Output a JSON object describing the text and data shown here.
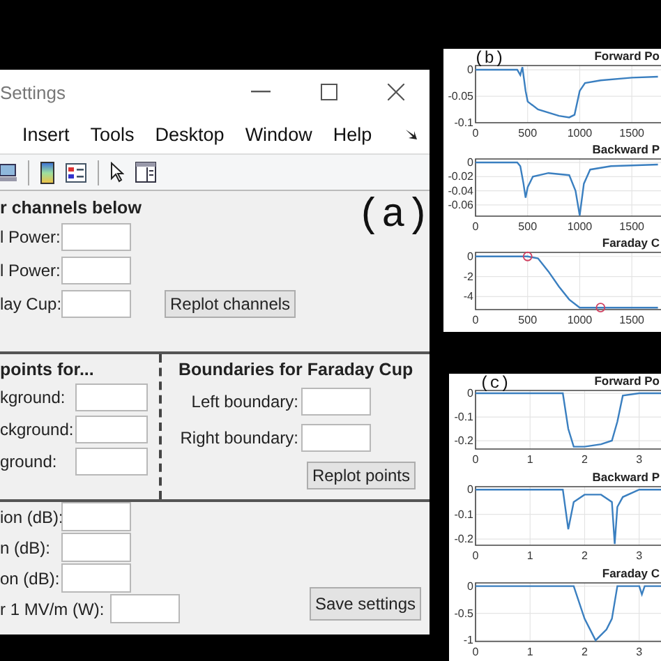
{
  "window": {
    "title": "Settings"
  },
  "menu": [
    "Insert",
    "Tools",
    "Desktop",
    "Window",
    "Help"
  ],
  "panel_label": "(a)",
  "channels": {
    "heading": "r channels below",
    "fields": [
      "l Power:",
      "l Power:",
      "lay Cup:"
    ],
    "button": "Replot channels"
  },
  "points": {
    "heading": "points for...",
    "fields": [
      "kground:",
      "ckground:",
      "ground:"
    ]
  },
  "boundaries": {
    "heading": "Boundaries for Faraday Cup",
    "fields": [
      "Left boundary:",
      "Right boundary:"
    ],
    "button": "Replot points"
  },
  "calibration": {
    "fields": [
      "ion (dB):",
      "n (dB):",
      "on (dB):",
      "r 1 MV/m (W):"
    ],
    "button": "Save settings"
  },
  "figures": [
    {
      "label": "(b)",
      "plots": [
        {
          "chart_data": {
            "type": "line",
            "title": "Forward Po",
            "grid": true,
            "x": [
              0,
              400,
              430,
              450,
              480,
              500,
              600,
              800,
              900,
              950,
              1000,
              1050,
              1200,
              1500,
              1750
            ],
            "series": [
              {
                "color": "#3a7fc0",
                "values": [
                  0,
                  0,
                  -0.01,
                  0.005,
                  -0.04,
                  -0.06,
                  -0.075,
                  -0.087,
                  -0.09,
                  -0.085,
                  -0.04,
                  -0.025,
                  -0.02,
                  -0.015,
                  -0.013
                ]
              }
            ],
            "xlim": [
              0,
              1780
            ],
            "ylim": [
              -0.1,
              0.008
            ],
            "xticks": [
              0,
              500,
              1000,
              1500
            ],
            "yticks": [
              0,
              -0.05,
              -0.1
            ]
          }
        },
        {
          "chart_data": {
            "type": "line",
            "title": "Backward P",
            "grid": true,
            "x": [
              0,
              400,
              430,
              460,
              480,
              500,
              550,
              700,
              900,
              960,
              1000,
              1040,
              1100,
              1300,
              1750
            ],
            "series": [
              {
                "color": "#3a7fc0",
                "values": [
                  0,
                  0,
                  -0.005,
                  -0.03,
                  -0.05,
                  -0.035,
                  -0.02,
                  -0.015,
                  -0.018,
                  -0.04,
                  -0.075,
                  -0.03,
                  -0.01,
                  -0.005,
                  -0.003
                ]
              }
            ],
            "xlim": [
              0,
              1780
            ],
            "ylim": [
              -0.076,
              0.005
            ],
            "xticks": [
              0,
              500,
              1000,
              1500
            ],
            "yticks": [
              0,
              -0.02,
              -0.04,
              -0.06
            ]
          }
        },
        {
          "chart_data": {
            "type": "line",
            "title": "Faraday C",
            "grid": true,
            "x": [
              0,
              500,
              600,
              700,
              800,
              900,
              1000,
              1200,
              1500,
              1750
            ],
            "series": [
              {
                "color": "#3a7fc0",
                "values": [
                  0,
                  0,
                  -0.2,
                  -1.5,
                  -3,
                  -4.3,
                  -5.1,
                  -5.1,
                  -5.1,
                  -5.1
                ]
              },
              {
                "type": "scatter",
                "color": "#d04060",
                "values": [
                  null,
                  0,
                  null,
                  null,
                  null,
                  null,
                  null,
                  -5.1,
                  null,
                  null
                ]
              }
            ],
            "xlim": [
              0,
              1780
            ],
            "ylim": [
              -5.3,
              0.4
            ],
            "xticks": [
              0,
              500,
              1000,
              1500
            ],
            "yticks": [
              0,
              -2,
              -4
            ]
          }
        }
      ]
    },
    {
      "label": "(c)",
      "plots": [
        {
          "chart_data": {
            "type": "line",
            "title": "Forward Po",
            "grid": true,
            "x": [
              0,
              1.6,
              1.7,
              1.8,
              2,
              2.3,
              2.5,
              2.6,
              2.7,
              3,
              3.4
            ],
            "series": [
              {
                "color": "#3a7fc0",
                "values": [
                  0,
                  0,
                  -0.15,
                  -0.225,
                  -0.225,
                  -0.215,
                  -0.2,
                  -0.12,
                  -0.01,
                  0,
                  0
                ]
              }
            ],
            "xlim": [
              0,
              3.4
            ],
            "ylim": [
              -0.235,
              0.012
            ],
            "xticks": [
              0,
              1,
              2,
              3
            ],
            "yticks": [
              0,
              -0.1,
              -0.2
            ]
          }
        },
        {
          "chart_data": {
            "type": "line",
            "title": "Backward P",
            "grid": true,
            "x": [
              0,
              1.6,
              1.7,
              1.8,
              2,
              2.3,
              2.5,
              2.55,
              2.6,
              2.7,
              3,
              3.4
            ],
            "series": [
              {
                "color": "#3a7fc0",
                "values": [
                  0,
                  0,
                  -0.16,
                  -0.05,
                  -0.02,
                  -0.02,
                  -0.05,
                  -0.22,
                  -0.07,
                  -0.03,
                  0,
                  0
                ]
              }
            ],
            "xlim": [
              0,
              3.4
            ],
            "ylim": [
              -0.225,
              0.012
            ],
            "xticks": [
              0,
              1,
              2,
              3
            ],
            "yticks": [
              0,
              -0.1,
              -0.2
            ]
          }
        },
        {
          "chart_data": {
            "type": "line",
            "title": "Faraday C",
            "grid": true,
            "x": [
              0,
              1.8,
              2,
              2.2,
              2.4,
              2.5,
              2.6,
              3,
              3.05,
              3.1,
              3.4
            ],
            "series": [
              {
                "color": "#3a7fc0",
                "values": [
                  0,
                  0,
                  -0.6,
                  -1,
                  -0.8,
                  -0.6,
                  0,
                  0,
                  -0.15,
                  0,
                  0
                ]
              }
            ],
            "xlim": [
              0,
              3.4
            ],
            "ylim": [
              -1.02,
              0.06
            ],
            "xticks": [
              0,
              1,
              2,
              3
            ],
            "yticks": [
              0,
              -0.5,
              -1
            ]
          }
        }
      ]
    }
  ]
}
